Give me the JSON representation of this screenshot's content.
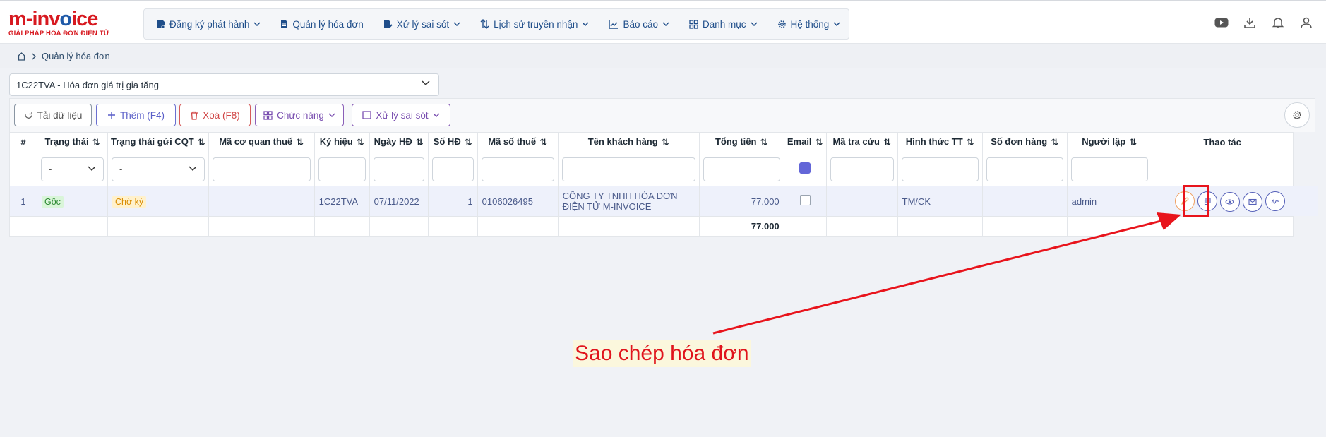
{
  "brand": {
    "name_part1": "m-inv",
    "name_part2": "o",
    "name_part3": "ice",
    "tagline": "GIẢI PHÁP HÓA ĐƠN ĐIỆN TỬ"
  },
  "nav": [
    {
      "label": "Đăng ký phát hành",
      "icon": "file-register-icon",
      "dropdown": true
    },
    {
      "label": "Quản lý hóa đơn",
      "icon": "file-icon",
      "dropdown": false
    },
    {
      "label": "Xử lý sai sót",
      "icon": "file-edit-icon",
      "dropdown": true
    },
    {
      "label": "Lịch sử truyền nhận",
      "icon": "arrows-updown-icon",
      "dropdown": true
    },
    {
      "label": "Báo cáo",
      "icon": "chart-line-icon",
      "dropdown": true
    },
    {
      "label": "Danh mục",
      "icon": "grid-icon",
      "dropdown": true
    },
    {
      "label": "Hệ thống",
      "icon": "gear-icon",
      "dropdown": true
    }
  ],
  "breadcrumb": {
    "current": "Quản lý hóa đơn"
  },
  "invoice_type": {
    "selected": "1C22TVA - Hóa đơn giá trị gia tăng"
  },
  "toolbar": {
    "reload": "Tải dữ liệu",
    "add": "Thêm (F4)",
    "delete": "Xoá (F8)",
    "functions": "Chức năng",
    "errors": "Xử lý sai sót"
  },
  "table": {
    "columns": [
      "#",
      "Trạng thái",
      "Trạng thái gửi CQT",
      "Mã cơ quan thuế",
      "Ký hiệu",
      "Ngày HĐ",
      "Số HĐ",
      "Mã số thuế",
      "Tên khách hàng",
      "Tổng tiền",
      "Email",
      "Mã tra cứu",
      "Hình thức TT",
      "Số đơn hàng",
      "Người lập",
      "Thao tác"
    ],
    "filters": {
      "status": "-",
      "cqt_status": "-"
    },
    "row": {
      "index": "1",
      "status": "Gốc",
      "cqt_status": "Chờ ký",
      "tax_office_code": "",
      "symbol": "1C22TVA",
      "date": "07/11/2022",
      "number": "1",
      "tax_id": "0106026495",
      "customer": "CÔNG TY TNHH HÓA ĐƠN ĐIỆN TỬ M-INVOICE",
      "total": "77.000",
      "lookup_code": "",
      "payment_method": "TM/CK",
      "order_no": "",
      "creator": "admin"
    },
    "sum_total": "77.000"
  },
  "annotation": {
    "caption": "Sao chép hóa đơn"
  },
  "colors": {
    "accent": "#1f4e8a",
    "brand_red": "#d71920",
    "annotation_red": "#e8141c",
    "purple": "#6366d8"
  }
}
